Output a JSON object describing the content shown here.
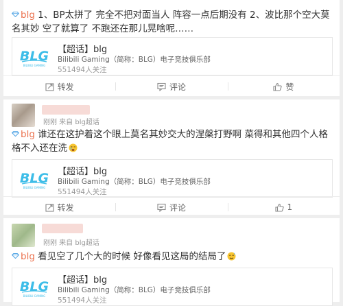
{
  "posts": [
    {
      "topic": "blg",
      "text": " 1、BP太拼了 完全不把对面当人 阵容一点后期没有 2、波比那个空大莫名其妙 空了就算了 不跑还在那儿晃啥呢……",
      "card": {
        "title": "【超话】blg",
        "desc": "Bilibili Gaming（简称：BLG）电子竞技俱乐部",
        "fans": "551494人关注"
      },
      "actions": {
        "repost": "转发",
        "comment": "评论",
        "like": "赞"
      }
    },
    {
      "time": "刚刚 来自 blg超话",
      "topic": "blg",
      "text": " 谁还在这护着这个眼上莫名其妙交大的涅槃打野啊 菜得和其他四个人格格不入还在洗",
      "emoji": "crying-emoji",
      "card": {
        "title": "【超话】blg",
        "desc": "Bilibili Gaming（简称：BLG）电子竞技俱乐部",
        "fans": "551494人关注"
      },
      "actions": {
        "repost": "转发",
        "comment": "评论",
        "like": "1"
      }
    },
    {
      "time": "刚刚 来自 blg超话",
      "topic": "blg",
      "text": " 看见空了几个大的时候 好像看见这局的结局了",
      "emoji": "sweat-emoji",
      "card": {
        "title": "【超话】blg",
        "desc": "Bilibili Gaming（简称：BLG）电子竞技俱乐部",
        "fans": "551494人关注"
      }
    }
  ],
  "logo": {
    "text": "BLG",
    "subtext": "BILIBILI GAMING",
    "color": "#3dbde8"
  },
  "colors": {
    "topic": "#eb7350",
    "background": "#eeeeee"
  }
}
